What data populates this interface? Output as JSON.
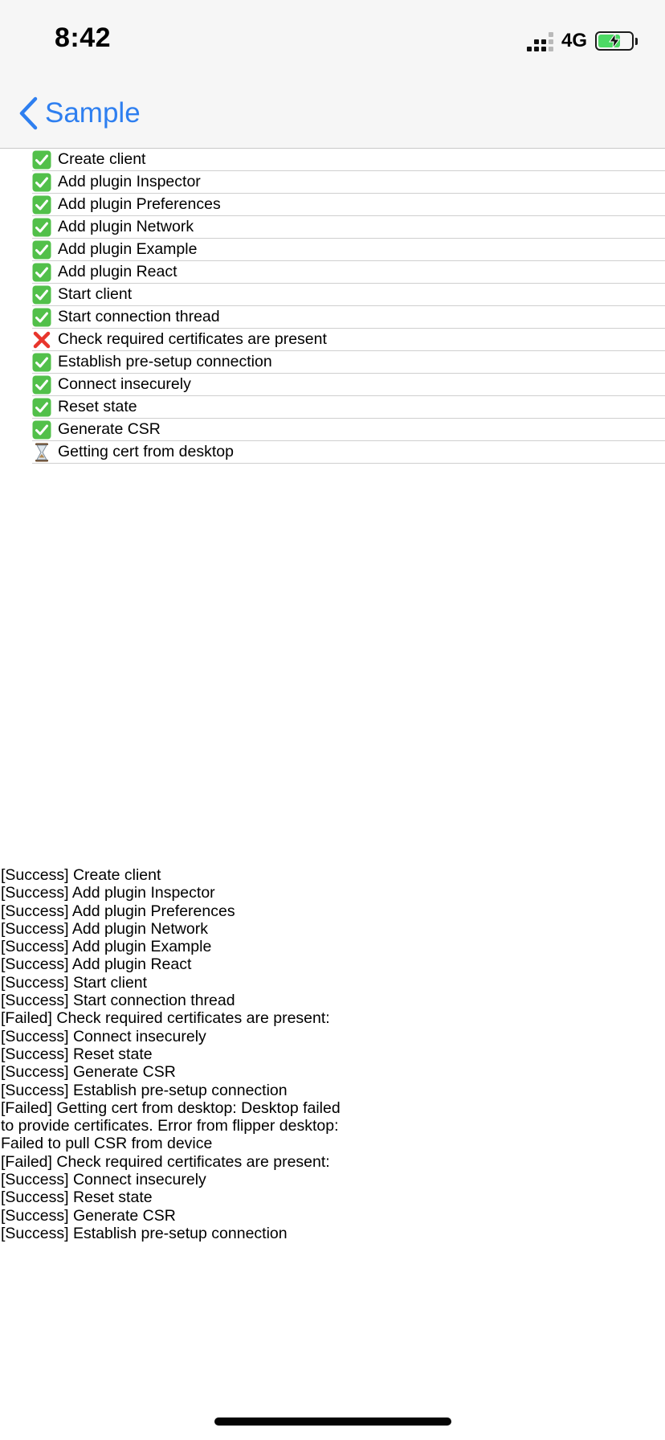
{
  "status_bar": {
    "time": "8:42",
    "network": "4G",
    "icons": [
      "signal-icon",
      "battery-charging-icon"
    ]
  },
  "nav": {
    "back_label": "Sample",
    "back_icon": "chevron-left-icon",
    "accent": "#2e7ff0"
  },
  "steps": [
    {
      "label": "Create client",
      "status": "success"
    },
    {
      "label": "Add plugin Inspector",
      "status": "success"
    },
    {
      "label": "Add plugin Preferences",
      "status": "success"
    },
    {
      "label": "Add plugin Network",
      "status": "success"
    },
    {
      "label": "Add plugin Example",
      "status": "success"
    },
    {
      "label": "Add plugin React",
      "status": "success"
    },
    {
      "label": "Start client",
      "status": "success"
    },
    {
      "label": "Start connection thread",
      "status": "success"
    },
    {
      "label": "Check required certificates are present",
      "status": "failed"
    },
    {
      "label": "Establish pre-setup connection",
      "status": "success"
    },
    {
      "label": "Connect insecurely",
      "status": "success"
    },
    {
      "label": "Reset state",
      "status": "success"
    },
    {
      "label": "Generate CSR",
      "status": "success"
    },
    {
      "label": "Getting cert from desktop",
      "status": "pending"
    }
  ],
  "log": [
    "[Success] Create client",
    "[Success] Add plugin Inspector",
    "[Success] Add plugin Preferences",
    "[Success] Add plugin Network",
    "[Success] Add plugin Example",
    "[Success] Add plugin React",
    "[Success] Start client",
    "[Success] Start connection thread",
    "[Failed] Check required certificates are present:",
    "[Success] Connect insecurely",
    "[Success] Reset state",
    "[Success] Generate CSR",
    "[Success] Establish pre-setup connection",
    "[Failed] Getting cert from desktop: Desktop failed to provide certificates. Error from flipper desktop:\nFailed to pull CSR from device",
    "[Failed] Check required certificates are present:",
    "[Success] Connect insecurely",
    "[Success] Reset state",
    "[Success] Generate CSR",
    "[Success] Establish pre-setup connection"
  ],
  "colors": {
    "success": "#52c04a",
    "failed": "#e8352c",
    "header_bg": "#f6f6f6"
  }
}
